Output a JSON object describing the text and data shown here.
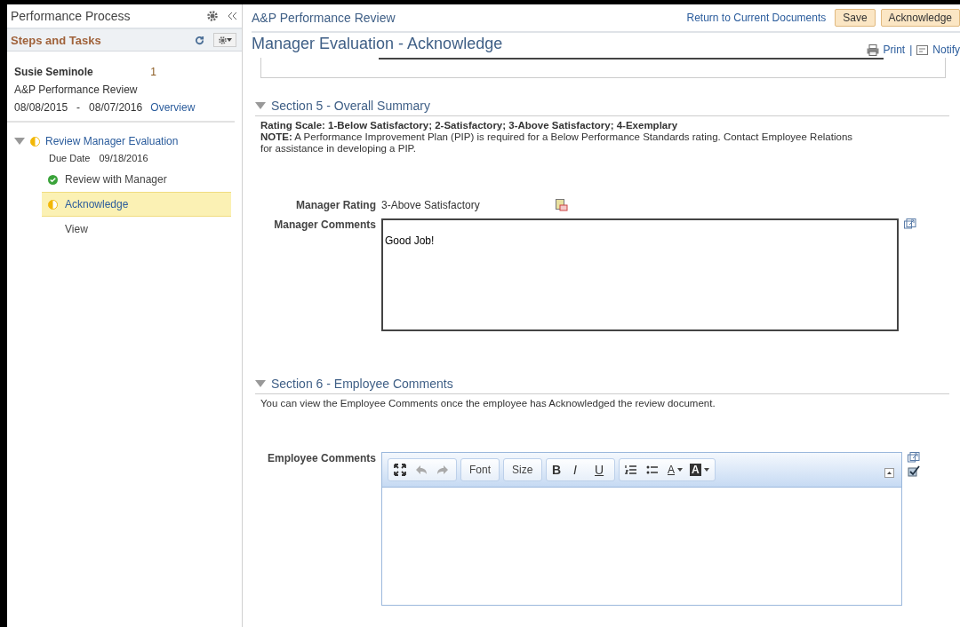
{
  "sidebar": {
    "title": "Performance Process",
    "section_title": "Steps and Tasks",
    "employee": {
      "name": "Susie Seminole",
      "count": "1",
      "document": "A&P Performance Review",
      "start": "08/08/2015",
      "separator": "-",
      "end": "08/07/2016",
      "link": "Overview"
    },
    "tasks": [
      {
        "label": "Review Manager Evaluation",
        "kind": "in_progress",
        "expanded": true,
        "due_label": "Due Date",
        "due_date": "09/18/2016",
        "children": [
          {
            "label": "Review with Manager",
            "kind": "complete",
            "selected": false
          },
          {
            "label": "Acknowledge",
            "kind": "in_progress",
            "selected": true
          },
          {
            "label": "View",
            "kind": "none",
            "selected": false
          }
        ]
      }
    ]
  },
  "header": {
    "title": "A&P Performance Review",
    "link": "Return to Current Documents",
    "buttons": [
      "Save",
      "Acknowledge"
    ],
    "page_title": "Manager Evaluation - Acknowledge",
    "actions": [
      {
        "kind": "print",
        "label": "Print"
      },
      {
        "kind": "notify",
        "label": "Notify"
      }
    ],
    "action_separator": "|"
  },
  "section5": {
    "title": "Section 5 - Overall Summary",
    "expanded": true,
    "scale": "Rating Scale: 1-Below Satisfactory; 2-Satisfactory; 3-Above Satisfactory; 4-Exemplary",
    "note": "**NOTE:** A Performance Improvement Plan (PIP) is required for a Below Performance Standards rating. Contact Employee Relations",
    "note_line2": "for assistance in developing a PIP.",
    "rating_label": "Manager Rating",
    "rating_value": "3-Above Satisfactory",
    "comments_label": "Manager Comments",
    "comments_value": "Good Job!"
  },
  "section6": {
    "title": "Section 6 - Employee Comments",
    "expanded": true,
    "info": "You can view the Employee Comments once the employee has Acknowledged the review document.",
    "comments_label": "Employee Comments",
    "toolbar": [
      [
        {
          "kind": "maximize"
        },
        {
          "kind": "undo"
        },
        {
          "kind": "redo"
        }
      ],
      [
        {
          "kind": "dropdown",
          "label": "Font"
        }
      ],
      [
        {
          "kind": "dropdown",
          "label": "Size"
        }
      ],
      [
        {
          "kind": "bold",
          "label": "B"
        },
        {
          "kind": "italic",
          "label": "I"
        },
        {
          "kind": "underline",
          "label": "U"
        }
      ],
      [
        {
          "kind": "numbered"
        },
        {
          "kind": "bulleted"
        },
        {
          "kind": "textcolor",
          "label": "A"
        },
        {
          "kind": "bgcolor",
          "label": "A"
        }
      ]
    ]
  }
}
